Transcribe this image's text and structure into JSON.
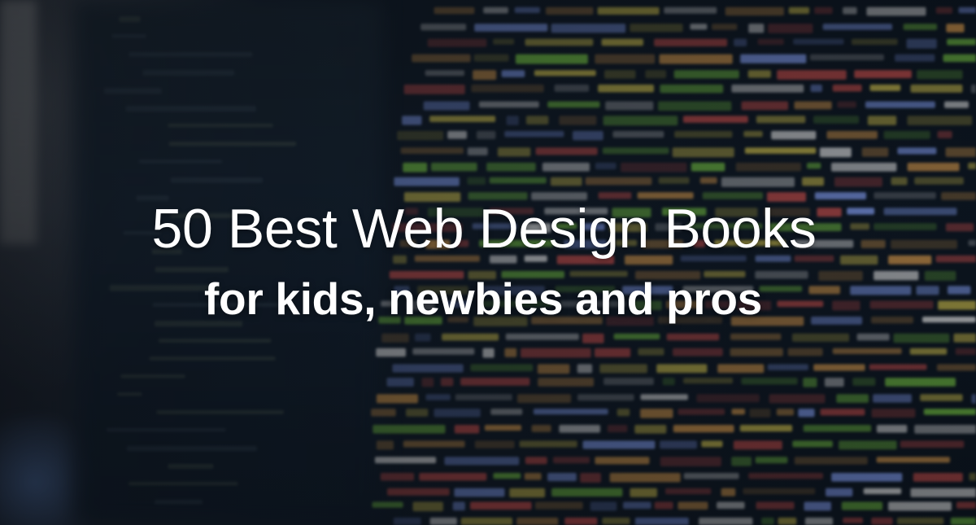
{
  "hero": {
    "title": "50 Best Web Design Books",
    "subtitle": "for kids, newbies and pros"
  },
  "background": {
    "code_colors": [
      "#d9c84f",
      "#7ccf45",
      "#d9534f",
      "#f2f2f2",
      "#e3a14e",
      "#8aa6ff"
    ]
  }
}
